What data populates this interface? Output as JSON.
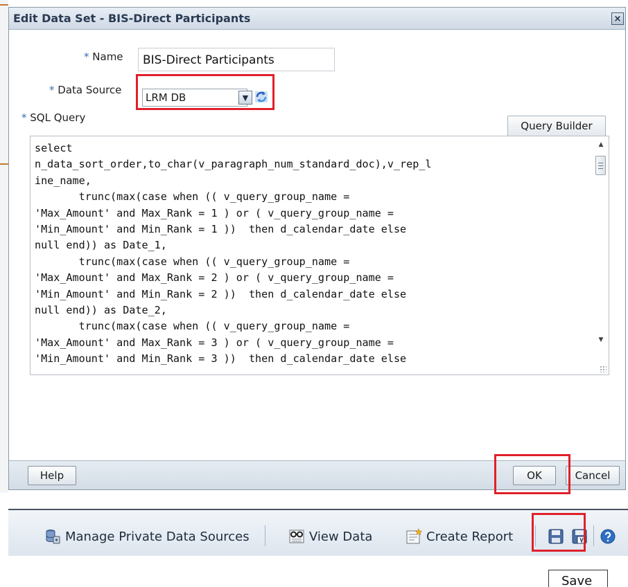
{
  "dialog": {
    "title": "Edit Data Set - BIS-Direct Participants",
    "close_glyph": "×",
    "name_label": "Name",
    "name_value": "BIS-Direct Participants",
    "data_source_label": "Data Source",
    "data_source_value": "LRM DB",
    "sql_query_label": "SQL Query",
    "query_builder_label": "Query Builder",
    "required_marker": "*",
    "sql_query_text": "select\nn_data_sort_order,to_char(v_paragraph_num_standard_doc),v_rep_l\nine_name,\n       trunc(max(case when (( v_query_group_name =\n'Max_Amount' and Max_Rank = 1 ) or ( v_query_group_name =\n'Min_Amount' and Min_Rank = 1 ))  then d_calendar_date else\nnull end)) as Date_1,\n       trunc(max(case when (( v_query_group_name =\n'Max_Amount' and Max_Rank = 2 ) or ( v_query_group_name =\n'Min_Amount' and Min_Rank = 2 ))  then d_calendar_date else\nnull end)) as Date_2,\n       trunc(max(case when (( v_query_group_name =\n'Max_Amount' and Max_Rank = 3 ) or ( v_query_group_name =\n'Min_Amount' and Min_Rank = 3 ))  then d_calendar_date else",
    "help_label": "Help",
    "ok_label": "OK",
    "cancel_label": "Cancel"
  },
  "toolbar": {
    "manage_sources_label": "Manage Private Data Sources",
    "view_data_label": "View Data",
    "create_report_label": "Create Report"
  },
  "tooltip": {
    "save_label": "Save"
  },
  "icons": {
    "manage_sources": "database-icon",
    "view_data": "glasses-icon",
    "create_report": "report-icon",
    "save": "floppy-disk-icon",
    "save_as": "floppy-disk-edit-icon",
    "help": "help-icon",
    "refresh": "refresh-icon"
  },
  "colors": {
    "highlight": "#e0202a",
    "title_text": "#2a3b52",
    "required": "#3a6fb0"
  }
}
